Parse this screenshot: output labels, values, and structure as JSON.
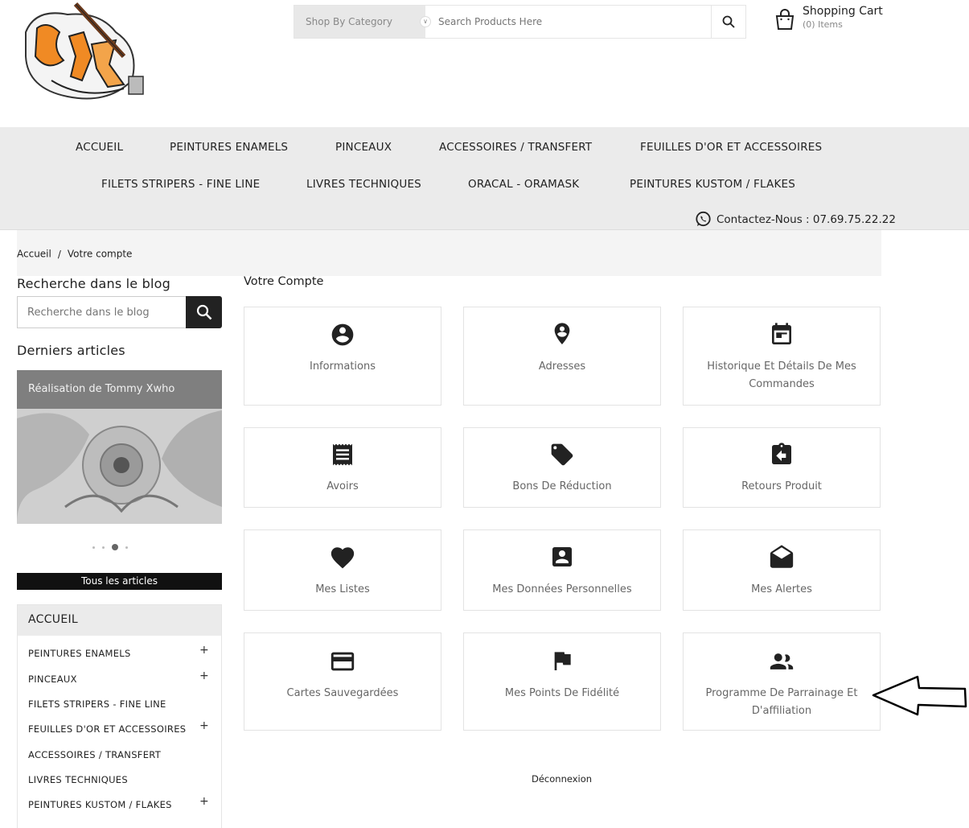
{
  "header": {
    "category_select": "Shop By Category",
    "search_placeholder": "Search Products Here",
    "cart_title": "Shopping Cart",
    "cart_count": "(0) Items"
  },
  "nav": {
    "items": [
      "ACCUEIL",
      "PEINTURES ENAMELS",
      "PINCEAUX",
      "ACCESSOIRES / TRANSFERT",
      "FEUILLES D'OR ET ACCESSOIRES",
      "FILETS STRIPERS - FINE LINE",
      "LIVRES TECHNIQUES",
      "ORACAL - ORAMASK",
      "PEINTURES KUSTOM / FLAKES"
    ],
    "contact": "Contactez-Nous : 07.69.75.22.22"
  },
  "breadcrumb": {
    "home": "Accueil",
    "separator": "/",
    "current": "Votre compte"
  },
  "sidebar": {
    "blog_search_title": "Recherche dans le blog",
    "blog_search_placeholder": "Recherche dans le blog",
    "latest_title": "Derniers articles",
    "latest_caption": "Réalisation de Tommy Xwho",
    "carousel_active_index": 2,
    "all_articles": "Tous les articles",
    "categories_header": "ACCUEIL",
    "categories": [
      {
        "label": "PEINTURES ENAMELS",
        "expandable": true
      },
      {
        "label": "PINCEAUX",
        "expandable": true
      },
      {
        "label": "FILETS STRIPERS - FINE LINE",
        "expandable": false
      },
      {
        "label": "FEUILLES D'OR ET ACCESSOIRES",
        "expandable": true
      },
      {
        "label": "ACCESSOIRES / TRANSFERT",
        "expandable": false
      },
      {
        "label": "LIVRES TECHNIQUES",
        "expandable": false
      },
      {
        "label": "PEINTURES KUSTOM / FLAKES",
        "expandable": true
      }
    ],
    "plus_symbol": "+"
  },
  "main": {
    "title": "Votre Compte",
    "cards": [
      {
        "label": "Informations",
        "icon": "account-circle-icon"
      },
      {
        "label": "Adresses",
        "icon": "location-pin-icon"
      },
      {
        "label": "Historique Et Détails De Mes Commandes",
        "icon": "calendar-icon"
      },
      {
        "label": "Avoirs",
        "icon": "receipt-icon"
      },
      {
        "label": "Bons De Réduction",
        "icon": "tag-icon"
      },
      {
        "label": "Retours Produit",
        "icon": "return-clipboard-icon"
      },
      {
        "label": "Mes Listes",
        "icon": "heart-icon"
      },
      {
        "label": "Mes Données Personnelles",
        "icon": "contact-card-icon"
      },
      {
        "label": "Mes Alertes",
        "icon": "mail-open-icon"
      },
      {
        "label": "Cartes Sauvegardées",
        "icon": "credit-card-icon"
      },
      {
        "label": "Mes Points De Fidélité",
        "icon": "flag-icon"
      },
      {
        "label": "Programme De Parrainage Et D'affiliation",
        "icon": "people-icon"
      }
    ],
    "logout": "Déconnexion"
  }
}
